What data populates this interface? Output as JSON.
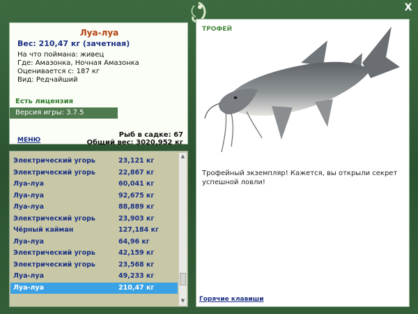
{
  "window": {
    "close_label": "X"
  },
  "info": {
    "fish_name": "Луа-луа",
    "weight_line": "Вес: 210,47 кг (зачетная)",
    "bait_line": "На что поймана: живец",
    "location_line": "Где: Амазонка, Ночная Амазонка",
    "value_line": "Оценивается с: 187 кг",
    "kind_line": "Вид: Редчайший",
    "license": "Есть лицензия",
    "version": "Версия игры: 3.7.5"
  },
  "menu": {
    "label": "МЕНЮ"
  },
  "stats": {
    "fish_in_keepnet": "Рыб в садке: 67",
    "total_weight": "Общий вес: 3020,952 кг"
  },
  "catch_list": [
    {
      "name": "Электрический угорь",
      "weight": "23,121 кг"
    },
    {
      "name": "Электрический угорь",
      "weight": "22,867 кг"
    },
    {
      "name": "Луа-луа",
      "weight": "60,041 кг"
    },
    {
      "name": "Луа-луа",
      "weight": "92,675 кг"
    },
    {
      "name": "Луа-луа",
      "weight": "88,889 кг"
    },
    {
      "name": "Электрический угорь",
      "weight": "23,903 кг"
    },
    {
      "name": "Чёрный кайман",
      "weight": "127,184 кг"
    },
    {
      "name": "Луа-луа",
      "weight": "64,96 кг"
    },
    {
      "name": "Электрический угорь",
      "weight": "42,159 кг"
    },
    {
      "name": "Электрический угорь",
      "weight": "23,568 кг"
    },
    {
      "name": "Луа-луа",
      "weight": "49,233 кг"
    },
    {
      "name": "Луа-луа",
      "weight": "210,47 кг"
    }
  ],
  "selected_index": 11,
  "trophy": {
    "title": "ТРОФЕЙ",
    "message": "Трофейный экземпляр! Кажется, вы открыли секрет успешной ловли!"
  },
  "footer": {
    "hotkeys": "Горячие клавиши"
  },
  "icons": {
    "logo": "fish-hook-logo-icon",
    "fish": "catfish-image",
    "scroll_up": "scroll-up-arrow-icon",
    "scroll_down": "scroll-down-arrow-icon"
  },
  "colors": {
    "frame": "#2e5a34",
    "fish_name": "#b5420f",
    "link_blue": "#1a2f84",
    "license_green": "#2f7a2b",
    "version_bar": "#4f7a4e",
    "list_bg": "#c8c8a7",
    "selected_row": "#3aa1e4"
  }
}
